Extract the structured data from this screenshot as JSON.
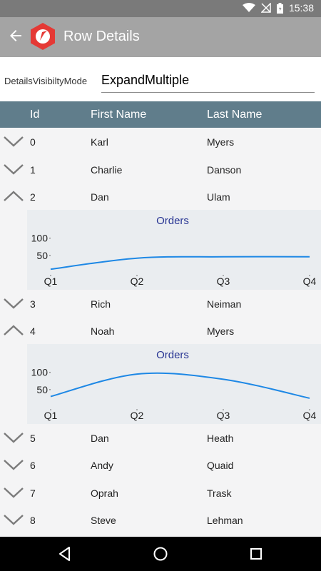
{
  "status": {
    "time": "15:38"
  },
  "appbar": {
    "title": "Row Details"
  },
  "mode": {
    "label": "DetailsVisibiltyMode",
    "value": "ExpandMultiple"
  },
  "columns": {
    "id": "Id",
    "first": "First Name",
    "last": "Last Name"
  },
  "rows": [
    {
      "id": "0",
      "first": "Karl",
      "last": "Myers",
      "expanded": false
    },
    {
      "id": "1",
      "first": "Charlie",
      "last": "Danson",
      "expanded": false
    },
    {
      "id": "2",
      "first": "Dan",
      "last": "Ulam",
      "expanded": true
    },
    {
      "id": "3",
      "first": "Rich",
      "last": "Neiman",
      "expanded": false
    },
    {
      "id": "4",
      "first": "Noah",
      "last": "Myers",
      "expanded": true
    },
    {
      "id": "5",
      "first": "Dan",
      "last": "Heath",
      "expanded": false
    },
    {
      "id": "6",
      "first": "Andy",
      "last": "Quaid",
      "expanded": false
    },
    {
      "id": "7",
      "first": "Oprah",
      "last": "Trask",
      "expanded": false
    },
    {
      "id": "8",
      "first": "Steve",
      "last": "Lehman",
      "expanded": false
    }
  ],
  "chart_data": [
    {
      "type": "line",
      "title": "Orders",
      "categories": [
        "Q1",
        "Q2",
        "Q3",
        "Q4"
      ],
      "values": [
        10,
        42,
        46,
        46
      ],
      "yticks": [
        "50",
        "100"
      ],
      "ylim": [
        0,
        120
      ],
      "color": "#1e88e5"
    },
    {
      "type": "line",
      "title": "Orders",
      "categories": [
        "Q1",
        "Q2",
        "Q3",
        "Q4"
      ],
      "values": [
        30,
        95,
        80,
        25
      ],
      "yticks": [
        "50",
        "100"
      ],
      "ylim": [
        0,
        120
      ],
      "color": "#1e88e5"
    }
  ],
  "colors": {
    "header": "#607d8b",
    "appbar": "#a4a4a4",
    "logo": "#e53935",
    "chartTitle": "#283593"
  },
  "icons": {
    "back": "arrow-left-icon",
    "expand": "chevron-down-icon",
    "collapse": "chevron-up-icon"
  }
}
